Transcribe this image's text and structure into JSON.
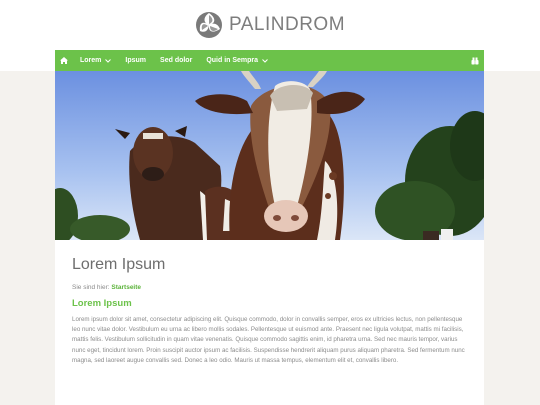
{
  "logo": {
    "text": "PALINDROM"
  },
  "nav": {
    "home_icon": "home-icon",
    "items": [
      {
        "label": "Lorem",
        "has_dropdown": true
      },
      {
        "label": "Ipsum",
        "has_dropdown": false
      },
      {
        "label": "Sed dolor",
        "has_dropdown": false
      },
      {
        "label": "Quid in Sempra",
        "has_dropdown": true
      }
    ],
    "search_icon": "search-icon"
  },
  "hero": {
    "icon": "cows-photo"
  },
  "main": {
    "title": "Lorem Ipsum",
    "breadcrumb": {
      "prefix": "Sie sind hier:",
      "current": "Startseite"
    },
    "section_title": "Lorem Ipsum",
    "body": "Lorem ipsum dolor sit amet, consectetur adipiscing elit. Quisque commodo, dolor in convallis semper, eros ex ultricies lectus, non pellentesque leo nunc vitae dolor. Vestibulum eu urna ac libero mollis sodales. Pellentesque ut euismod ante. Praesent nec ligula volutpat, mattis mi facilisis, mattis felis. Vestibulum sollicitudin in quam vitae venenatis. Quisque commodo sagittis enim, id pharetra urna. Sed nec mauris tempor, varius nunc eget, tincidunt lorem. Proin suscipit auctor ipsum ac facilisis. Suspendisse hendrerit aliquam purus aliquam pharetra. Sed fermentum nunc magna, sed laoreet augue convallis sed. Donec a leo odio. Mauris ut massa tempus, elementum elit et, convallis libero."
  },
  "colors": {
    "accent": "#6cc24a",
    "link": "#5bb33a",
    "background": "#f4f2ee",
    "text": "#8c8c8c",
    "title": "#6e6e6e"
  }
}
